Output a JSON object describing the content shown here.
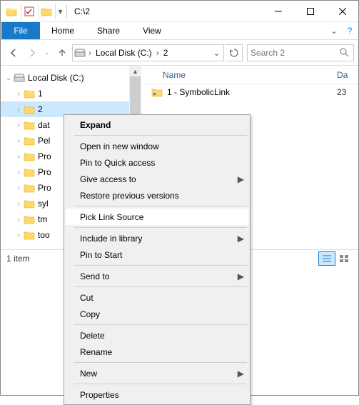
{
  "title": "C:\\2",
  "ribbon": {
    "file": "File",
    "home": "Home",
    "share": "Share",
    "view": "View"
  },
  "breadcrumb": {
    "root": "Local Disk (C:)",
    "folder": "2"
  },
  "search": {
    "placeholder": "Search 2"
  },
  "tree": {
    "root": "Local Disk (C:)",
    "items": [
      "1",
      "2",
      "dat",
      "Pel",
      "Pro",
      "Pro",
      "Pro",
      "syl",
      "tm",
      "too"
    ]
  },
  "columns": {
    "name": "Name",
    "date": "Da"
  },
  "files": [
    {
      "name": "1 - SymbolicLink",
      "date": "23"
    }
  ],
  "status": "1 item",
  "menu": {
    "expand": "Expand",
    "open_new": "Open in new window",
    "pin_qa": "Pin to Quick access",
    "give_access": "Give access to",
    "restore": "Restore previous versions",
    "pick_link": "Pick Link Source",
    "include_lib": "Include in library",
    "pin_start": "Pin to Start",
    "send_to": "Send to",
    "cut": "Cut",
    "copy": "Copy",
    "delete": "Delete",
    "rename": "Rename",
    "new": "New",
    "properties": "Properties"
  }
}
